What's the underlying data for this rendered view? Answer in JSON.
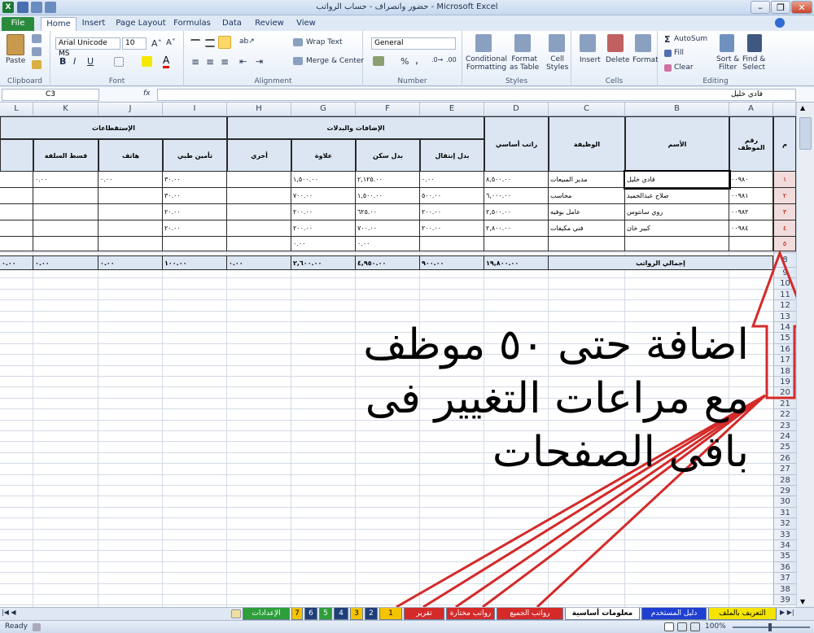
{
  "window": {
    "title": "حضور وانصراف - حساب الرواتب  -  Microsoft Excel"
  },
  "ribbon_tabs": [
    "File",
    "Home",
    "Insert",
    "Page Layout",
    "Formulas",
    "Data",
    "Review",
    "View"
  ],
  "ribbon": {
    "clipboard": {
      "label": "Clipboard",
      "paste": "Paste"
    },
    "font": {
      "label": "Font",
      "name": "Arial Unicode MS",
      "size": "10",
      "bold": "B",
      "italic": "I",
      "underline": "U"
    },
    "alignment": {
      "label": "Alignment",
      "wrap": "Wrap Text",
      "merge": "Merge & Center"
    },
    "number": {
      "label": "Number",
      "format": "General",
      "percent": "%"
    },
    "styles": {
      "label": "Styles",
      "cond1": "Conditional",
      "cond2": "Formatting",
      "fmt1": "Format",
      "fmt2": "as Table",
      "cell1": "Cell",
      "cell2": "Styles"
    },
    "cells": {
      "label": "Cells",
      "insert": "Insert",
      "delete": "Delete",
      "format": "Format"
    },
    "editing": {
      "label": "Editing",
      "autosum": "AutoSum",
      "fill": "Fill",
      "clear": "Clear",
      "sort1": "Sort &",
      "sort2": "Filter",
      "find1": "Find &",
      "find2": "Select"
    }
  },
  "formula_bar": {
    "name_box": "C3",
    "fx": "fx",
    "value": "فادي خليل"
  },
  "columns": [
    "L",
    "K",
    "J",
    "I",
    "H",
    "G",
    "F",
    "E",
    "D",
    "C",
    "B",
    "A"
  ],
  "row_numbers": [
    "1",
    "2",
    "3",
    "4",
    "5",
    "6",
    "7",
    "8",
    "9",
    "10",
    "11",
    "12",
    "13",
    "14",
    "15",
    "16",
    "17",
    "18",
    "19",
    "20",
    "21",
    "22",
    "23",
    "24",
    "25",
    "26",
    "27",
    "28",
    "29",
    "30",
    "31",
    "32",
    "33",
    "34",
    "35",
    "36",
    "37",
    "38",
    "39"
  ],
  "table": {
    "h_index": "م",
    "h_empid": "رقم الموظف",
    "h_name": "الأسم",
    "h_job": "الوظيفة",
    "h_basic": "راتب أساسي",
    "h_additions": "الإضافات والبدلات",
    "h_deductions": "الإستقطاعات",
    "h_transport": "بدل إنتقال",
    "h_housing": "بدل سكن",
    "h_bonus": "علاوة",
    "h_other": "أخري",
    "h_medical": "تأمين طبي",
    "h_phone": "هاتف",
    "h_loan": "قسط السلفة",
    "rows": [
      {
        "idx": "١",
        "id": "٠٠٩٨٠",
        "name": "فادي خليل",
        "job": "مدير المبيعات",
        "basic": "٨,٥٠٠.٠٠",
        "transport": "٠.٠٠",
        "housing": "٢,١٢٥.٠٠",
        "bonus": "١,٥٠٠.٠٠",
        "other": "",
        "medical": "٣٠.٠٠",
        "phone": "٠.٠٠",
        "loan": "٠.٠٠"
      },
      {
        "idx": "٢",
        "id": "٠٠٩٨١",
        "name": "صلاح عبدالحميد",
        "job": "محاسب",
        "basic": "٦,٠٠٠.٠٠",
        "transport": "٥٠٠.٠٠",
        "housing": "١,٥٠٠.٠٠",
        "bonus": "٧٠٠.٠٠",
        "other": "",
        "medical": "٣٠.٠٠",
        "phone": "",
        "loan": ""
      },
      {
        "idx": "٣",
        "id": "٠٠٩٨٢",
        "name": "روي سانتوس",
        "job": "عامل بوفيه",
        "basic": "٢,٥٠٠.٠٠",
        "transport": "٢٠٠.٠٠",
        "housing": "٦٢٥.٠٠",
        "bonus": "٢٠٠.٠٠",
        "other": "",
        "medical": "٢٠.٠٠",
        "phone": "",
        "loan": ""
      },
      {
        "idx": "٤",
        "id": "٠٠٩٨٤",
        "name": "كبير خان",
        "job": "فني مكيفات",
        "basic": "٢,٨٠٠.٠٠",
        "transport": "٢٠٠.٠٠",
        "housing": "٧٠٠.٠٠",
        "bonus": "٢٠٠.٠٠",
        "other": "",
        "medical": "٢٠.٠٠",
        "phone": "",
        "loan": ""
      },
      {
        "idx": "٥",
        "id": "",
        "name": "",
        "job": "",
        "basic": "",
        "transport": "",
        "housing": "٠.٠٠",
        "bonus": "٠.٠٠",
        "other": "",
        "medical": "",
        "phone": "",
        "loan": ""
      }
    ],
    "total_label": "إجمالي الرواتب",
    "totals": {
      "basic": "١٩,٨٠٠.٠٠",
      "transport": "٩٠٠.٠٠",
      "housing": "٤,٩٥٠.٠٠",
      "bonus": "٢,٦٠٠.٠٠",
      "other": "٠.٠٠",
      "medical": "١٠٠.٠٠",
      "phone": "٠.٠٠",
      "loan": "٠.٠٠",
      "extra": "٠.٠٠"
    }
  },
  "annotation": {
    "line1": "اضافة حتى ٥٠ موظف",
    "line2": "مع مراعات التغيير فى",
    "line3": "باقى الصفحات"
  },
  "sheet_tabs": [
    {
      "label": "الإعدادات",
      "color": "#2e9e3a"
    },
    {
      "label": "7",
      "color": "#f5c400"
    },
    {
      "label": "6",
      "color": "#1f3f7a"
    },
    {
      "label": "5",
      "color": "#2e9e3a"
    },
    {
      "label": "4",
      "color": "#1f3f7a"
    },
    {
      "label": "3",
      "color": "#f5c400"
    },
    {
      "label": "2",
      "color": "#1f3f7a"
    },
    {
      "label": "1",
      "color": "#f5c400"
    },
    {
      "label": "تقرير موظف",
      "color": "#d42a2a"
    },
    {
      "label": "رواتب مختارة",
      "color": "#d42a2a"
    },
    {
      "label": "رواتب الجميع",
      "color": "#d42a2a"
    },
    {
      "label": "معلومات أساسية",
      "color": "#ffffff"
    },
    {
      "label": "دليل المستخدم",
      "color": "#1f3fd0"
    },
    {
      "label": "التعريف بالملف",
      "color": "#f5e400"
    }
  ],
  "status": {
    "ready": "Ready",
    "zoom": "100%"
  }
}
